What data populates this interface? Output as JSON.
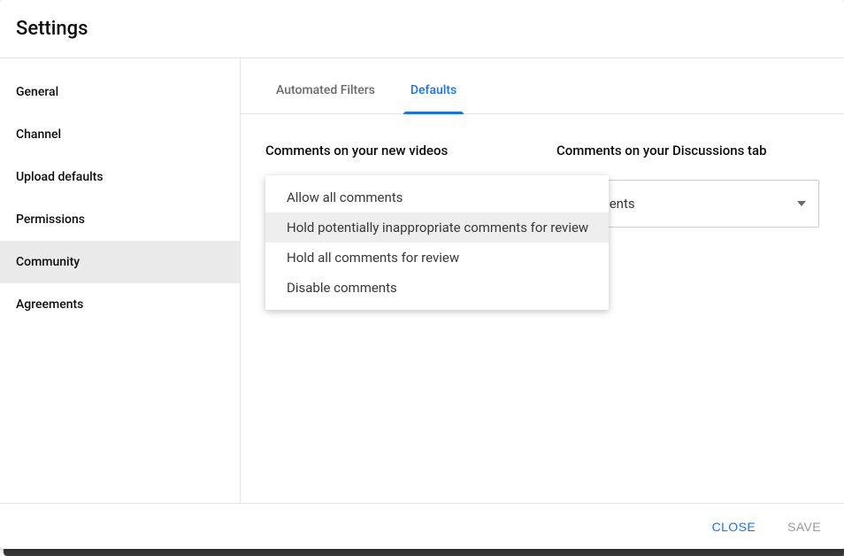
{
  "title": "Settings",
  "sidebar": {
    "items": [
      {
        "label": "General",
        "selected": false
      },
      {
        "label": "Channel",
        "selected": false
      },
      {
        "label": "Upload defaults",
        "selected": false
      },
      {
        "label": "Permissions",
        "selected": false
      },
      {
        "label": "Community",
        "selected": true
      },
      {
        "label": "Agreements",
        "selected": false
      }
    ]
  },
  "tabs": [
    {
      "label": "Automated Filters",
      "active": false
    },
    {
      "label": "Defaults",
      "active": true
    }
  ],
  "sections": {
    "new_videos": {
      "title": "Comments on your new videos"
    },
    "discussions": {
      "title": "Comments on your Discussions tab",
      "selected_visible": "comments"
    }
  },
  "dropdown": {
    "options": [
      {
        "label": "Allow all comments",
        "highlight": false
      },
      {
        "label": "Hold potentially inappropriate comments for review",
        "highlight": true
      },
      {
        "label": "Hold all comments for review",
        "highlight": false
      },
      {
        "label": "Disable comments",
        "highlight": false
      }
    ]
  },
  "footer": {
    "close": "CLOSE",
    "save": "SAVE"
  }
}
